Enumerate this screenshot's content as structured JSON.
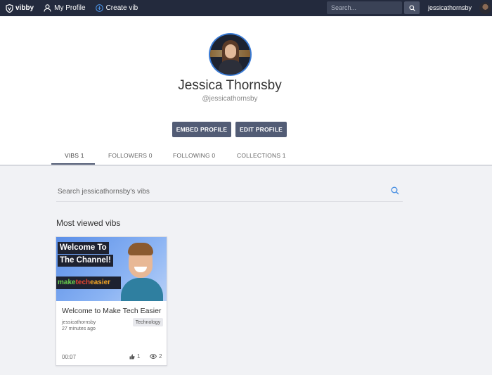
{
  "nav": {
    "brand": "vibby",
    "my_profile": "My Profile",
    "create_vib": "Create vib",
    "search_placeholder": "Search...",
    "username": "jessicathornsby"
  },
  "profile": {
    "name": "Jessica Thornsby",
    "handle": "@jessicathornsby",
    "embed_button": "EMBED PROFILE",
    "edit_button": "EDIT PROFILE",
    "tabs": [
      {
        "label": "VIBS 1",
        "active": true
      },
      {
        "label": "FOLLOWERS 0",
        "active": false
      },
      {
        "label": "FOLLOWING 0",
        "active": false
      },
      {
        "label": "COLLECTIONS 1",
        "active": false
      }
    ]
  },
  "content": {
    "search_placeholder": "Search jessicathornsby's vibs",
    "section_title": "Most viewed vibs"
  },
  "card": {
    "thumb_line1": "Welcome To",
    "thumb_line2": "The Channel!",
    "thumb_brand_1": "make",
    "thumb_brand_2": "tech",
    "thumb_brand_3": "easier",
    "title": "Welcome to Make Tech Easier",
    "author": "jessicathornsby",
    "time": "27 minutes ago",
    "tag": "Technology",
    "duration": "00:07",
    "likes": "1",
    "views": "2"
  },
  "colors": {
    "topbar": "#232a3d",
    "button": "#525c75",
    "accent": "#3a7bd5"
  }
}
